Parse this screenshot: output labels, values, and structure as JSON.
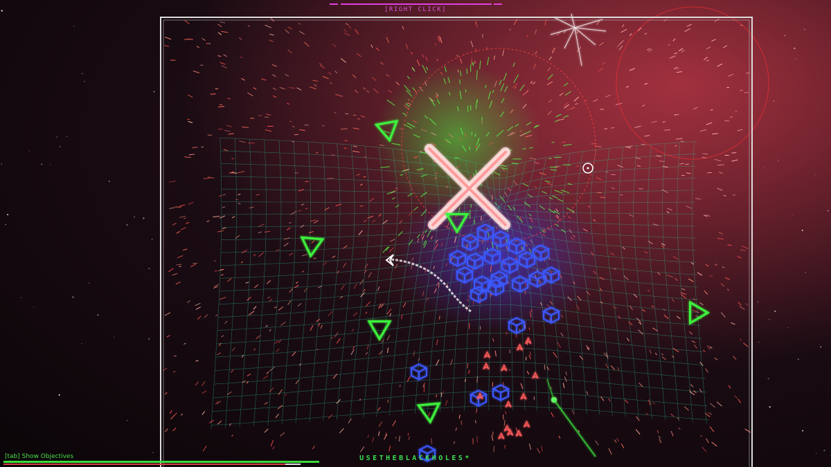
{
  "hud": {
    "top_hint": "[RIGHT CLICK]",
    "objectives_hint": "[tab] Show Objectives",
    "center_message": "USETHEBLACKHOLES*",
    "health_fraction": 1.0,
    "energy_fraction": 0.95
  },
  "colors": {
    "enemy_triangle": "#3df23d",
    "enemy_cube": "#3a58ff",
    "arena_border": "#dddddd",
    "particle_red": "#ff6a5a",
    "grid_green": "#2fd0a0",
    "hint_magenta": "#e050e0"
  },
  "entities": {
    "triangle_enemies": 6,
    "cube_enemies": 24,
    "icons": [
      "player-ship-icon",
      "crosshair-icon",
      "black-hole-icon",
      "x-explosion-icon"
    ]
  }
}
